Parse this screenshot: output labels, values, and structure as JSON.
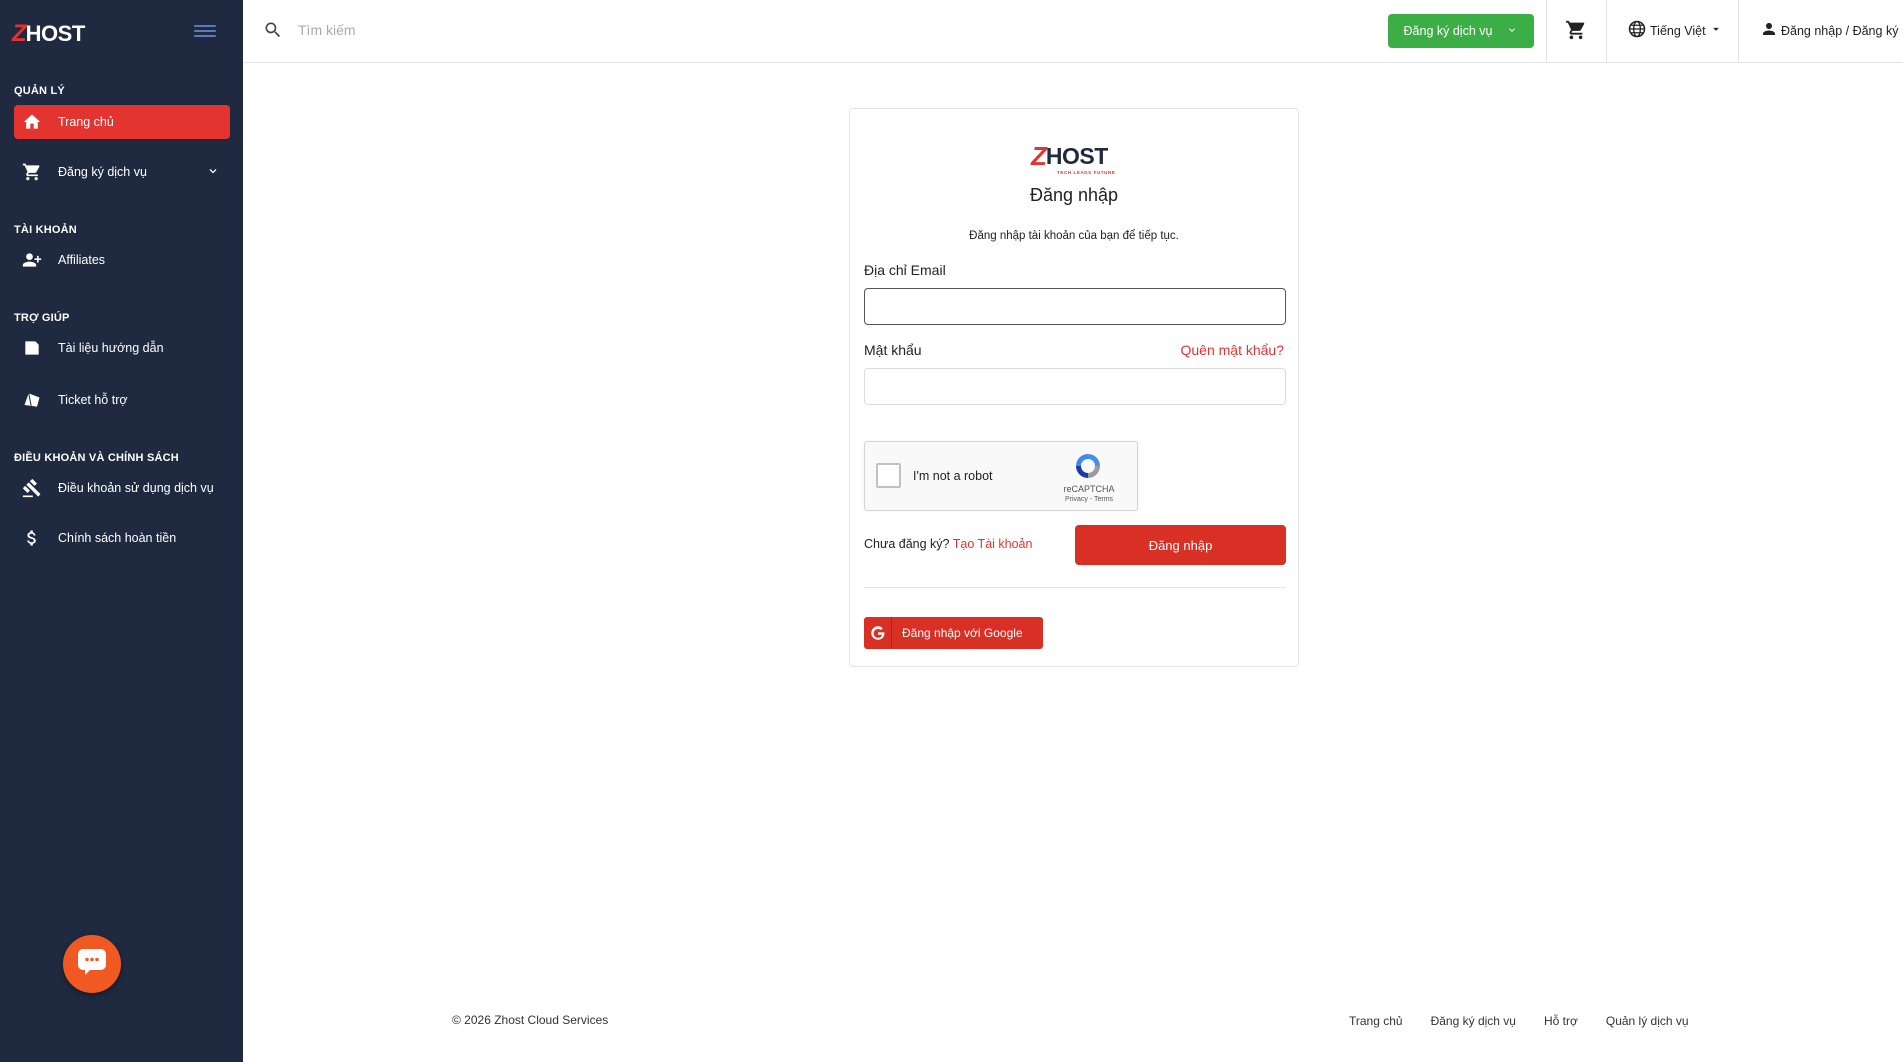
{
  "brand": {
    "z": "Z",
    "host": "HOST",
    "tagline": "TECH LEADS FUTURE"
  },
  "sidebar": {
    "sections": [
      {
        "title": "QUẢN LÝ"
      },
      {
        "title": "TÀI KHOẢN"
      },
      {
        "title": "TRỢ GIÚP"
      },
      {
        "title": "ĐIỀU KHOẢN VÀ CHÍNH SÁCH"
      }
    ],
    "items": [
      {
        "label": "Trang chủ",
        "icon": "home-icon",
        "active": true
      },
      {
        "label": "Đăng ký dịch vụ",
        "icon": "cart-icon"
      },
      {
        "label": "Affiliates",
        "icon": "user-add-icon"
      },
      {
        "label": "Tài liệu hướng dẫn",
        "icon": "book-icon"
      },
      {
        "label": "Ticket hỗ trợ",
        "icon": "ticket-icon"
      },
      {
        "label": "Điều khoản sử dụng dịch vụ",
        "icon": "gavel-icon"
      },
      {
        "label": "Chính sách hoàn tiền",
        "icon": "dollar-icon"
      }
    ]
  },
  "header": {
    "search_placeholder": "Tìm kiếm",
    "register_label": "Đăng ký dịch vụ",
    "language_label": "Tiếng Việt",
    "auth_label": "Đăng nhập / Đăng ký"
  },
  "login": {
    "title": "Đăng nhập",
    "subtitle": "Đăng nhập tài khoản của bạn để tiếp tục.",
    "email_label": "Địa chỉ Email",
    "email_value": "",
    "password_label": "Mật khẩu",
    "forgot_label": "Quên mật khẩu?",
    "recaptcha_label": "I'm not a robot",
    "recaptcha_brand": "reCAPTCHA",
    "recaptcha_terms": "Privacy - Terms",
    "signup_prompt": "Chưa đăng ký?",
    "signup_link": "Tạo Tài khoản",
    "submit_label": "Đăng nhập",
    "google_label": "Đăng nhập với Google"
  },
  "footer": {
    "copyright": "© 2026 Zhost Cloud Services",
    "links": [
      "Trang chủ",
      "Đăng ký dịch vụ",
      "Hỗ trợ",
      "Quản lý dịch vụ"
    ]
  },
  "colors": {
    "accent": "#e3342f",
    "sidebar_bg": "#1f2940",
    "register_green": "#3cae46",
    "chat_orange": "#f05a22"
  }
}
